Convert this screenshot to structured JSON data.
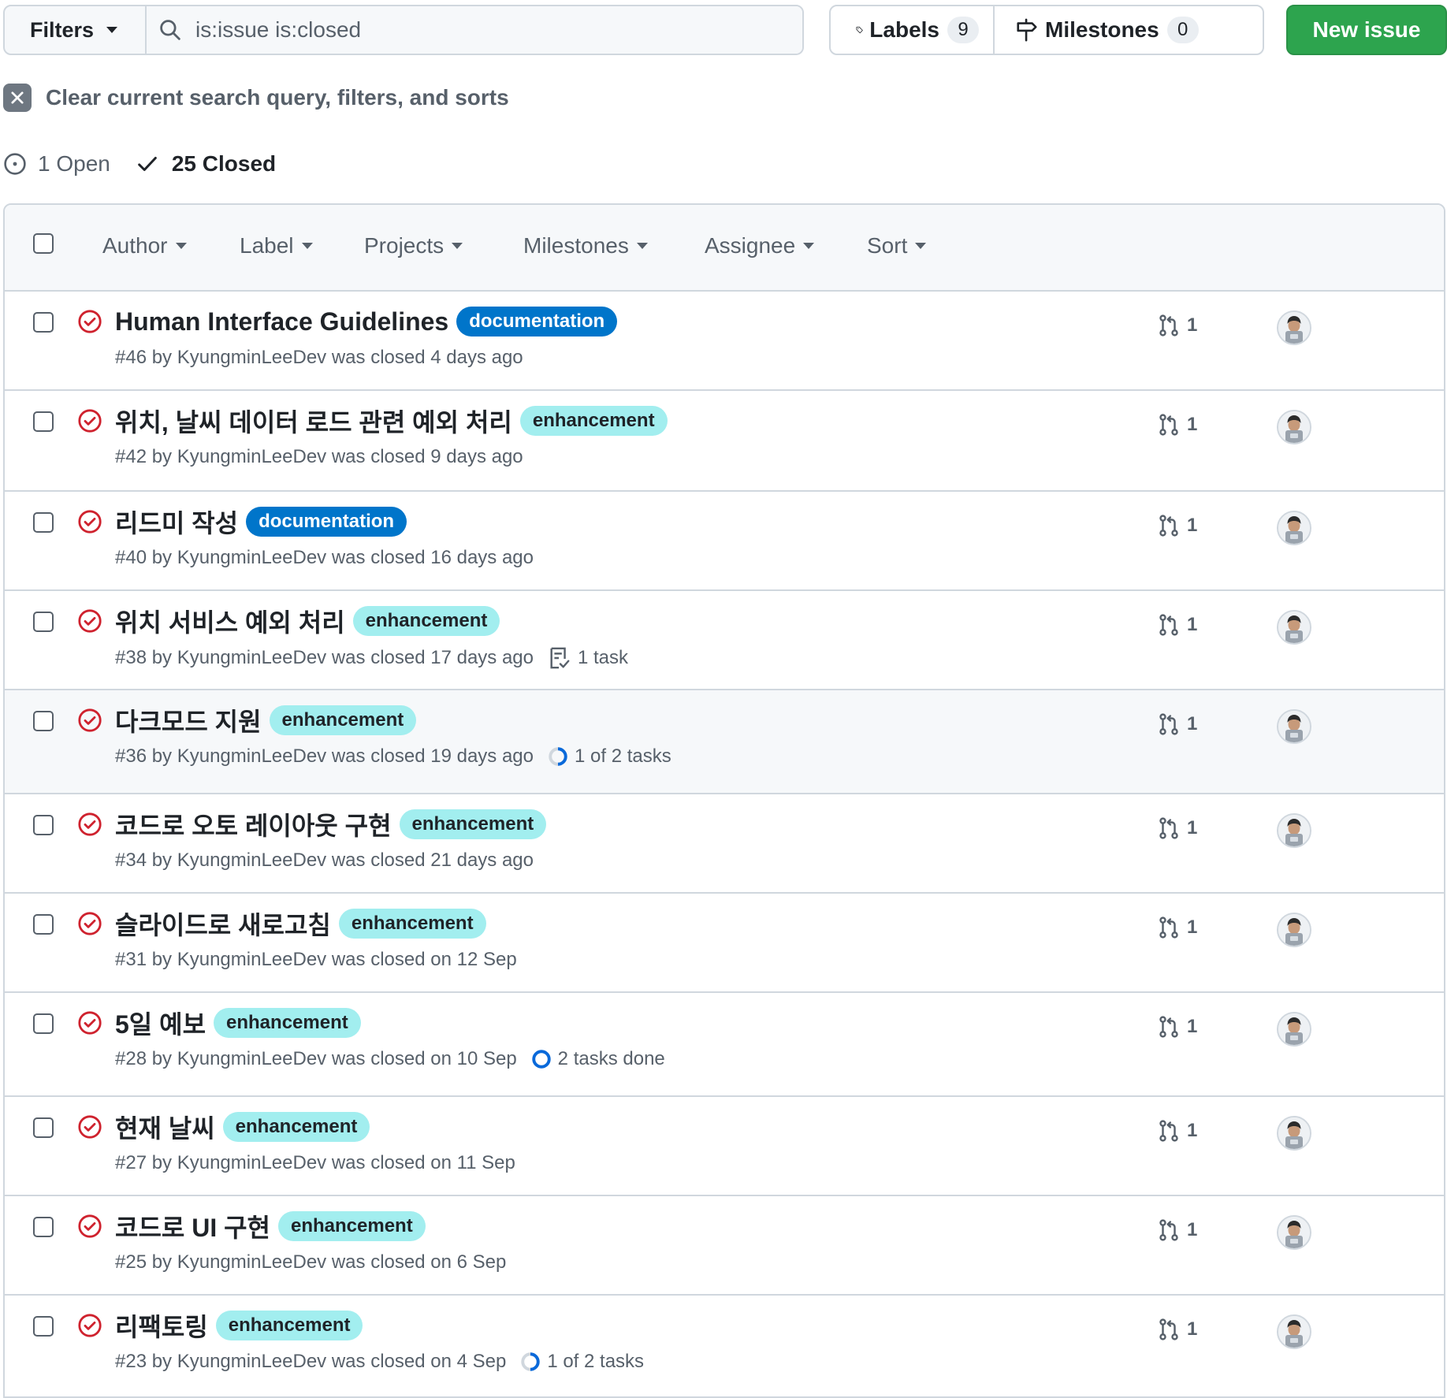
{
  "toolbar": {
    "filters_label": "Filters",
    "search_value": "is:issue is:closed",
    "labels_label": "Labels",
    "labels_count": "9",
    "milestones_label": "Milestones",
    "milestones_count": "0",
    "new_issue_label": "New issue"
  },
  "clear_query_label": "Clear current search query, filters, and sorts",
  "states": {
    "open": "1 Open",
    "closed": "25 Closed"
  },
  "header_filters": [
    "Author",
    "Label",
    "Projects",
    "Milestones",
    "Assignee",
    "Sort"
  ],
  "issues": [
    {
      "title": "Human Interface Guidelines",
      "label": "documentation",
      "meta": "#46 by KyungminLeeDev was closed 4 days ago",
      "extra": "",
      "extra_icon": "",
      "pr_count": "1"
    },
    {
      "title": "위치, 날씨 데이터 로드 관련 예외 처리",
      "label": "enhancement",
      "meta": "#42 by KyungminLeeDev was closed 9 days ago",
      "extra": "",
      "extra_icon": "",
      "pr_count": "1"
    },
    {
      "title": "리드미 작성",
      "label": "documentation",
      "meta": "#40 by KyungminLeeDev was closed 16 days ago",
      "extra": "",
      "extra_icon": "",
      "pr_count": "1"
    },
    {
      "title": "위치 서비스 예외 처리",
      "label": "enhancement",
      "meta": "#38 by KyungminLeeDev was closed 17 days ago",
      "extra": "1 task",
      "extra_icon": "task-list-icon",
      "pr_count": "1"
    },
    {
      "title": "다크모드 지원",
      "label": "enhancement",
      "meta": "#36 by KyungminLeeDev was closed 19 days ago",
      "extra": "1 of 2 tasks",
      "extra_icon": "progress-half-icon",
      "pr_count": "1"
    },
    {
      "title": "코드로 오토 레이아웃 구현",
      "label": "enhancement",
      "meta": "#34 by KyungminLeeDev was closed 21 days ago",
      "extra": "",
      "extra_icon": "",
      "pr_count": "1"
    },
    {
      "title": "슬라이드로 새로고침",
      "label": "enhancement",
      "meta": "#31 by KyungminLeeDev was closed on 12 Sep",
      "extra": "",
      "extra_icon": "",
      "pr_count": "1"
    },
    {
      "title": "5일 예보",
      "label": "enhancement",
      "meta": "#28 by KyungminLeeDev was closed on 10 Sep",
      "extra": "2 tasks done",
      "extra_icon": "progress-full-icon",
      "pr_count": "1"
    },
    {
      "title": "현재 날씨",
      "label": "enhancement",
      "meta": "#27 by KyungminLeeDev was closed on 11 Sep",
      "extra": "",
      "extra_icon": "",
      "pr_count": "1"
    },
    {
      "title": "코드로 UI 구현",
      "label": "enhancement",
      "meta": "#25 by KyungminLeeDev was closed on 6 Sep",
      "extra": "",
      "extra_icon": "",
      "pr_count": "1"
    },
    {
      "title": "리팩토링",
      "label": "enhancement",
      "meta": "#23 by KyungminLeeDev was closed on 4 Sep",
      "extra": "1 of 2 tasks",
      "extra_icon": "progress-half-icon",
      "pr_count": "1"
    }
  ],
  "colors": {
    "closed_icon": "#cf222e",
    "documentation_label": "#0075ca",
    "enhancement_label": "#a2eeef",
    "new_issue_button": "#2da44e",
    "progress": "#0969da"
  }
}
